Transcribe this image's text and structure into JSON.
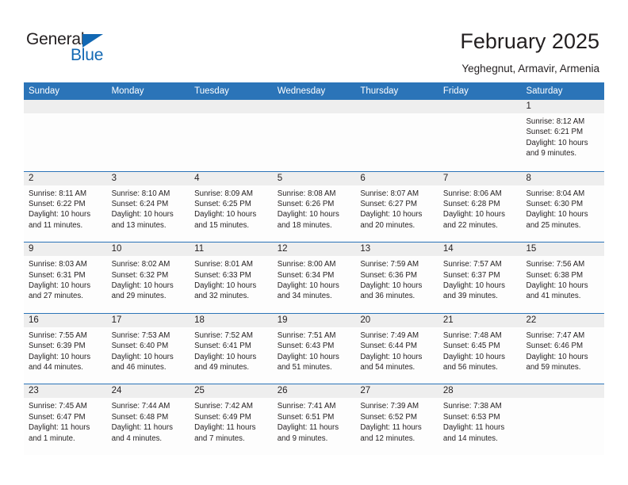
{
  "brand": {
    "name_part1": "General",
    "name_part2": "Blue",
    "accent_color": "#1268b3",
    "triangle_icon": "triangle-icon"
  },
  "header": {
    "title": "February 2025",
    "subtitle": "Yeghegnut, Armavir, Armenia"
  },
  "calendar": {
    "header_bg": "#2b74b8",
    "daynum_bg": "#eeeeee",
    "weekdays": [
      "Sunday",
      "Monday",
      "Tuesday",
      "Wednesday",
      "Thursday",
      "Friday",
      "Saturday"
    ],
    "weeks": [
      [
        {
          "day": "",
          "empty": true
        },
        {
          "day": "",
          "empty": true
        },
        {
          "day": "",
          "empty": true
        },
        {
          "day": "",
          "empty": true
        },
        {
          "day": "",
          "empty": true
        },
        {
          "day": "",
          "empty": true
        },
        {
          "day": "1",
          "sunrise": "Sunrise: 8:12 AM",
          "sunset": "Sunset: 6:21 PM",
          "daylight": "Daylight: 10 hours and 9 minutes."
        }
      ],
      [
        {
          "day": "2",
          "sunrise": "Sunrise: 8:11 AM",
          "sunset": "Sunset: 6:22 PM",
          "daylight": "Daylight: 10 hours and 11 minutes."
        },
        {
          "day": "3",
          "sunrise": "Sunrise: 8:10 AM",
          "sunset": "Sunset: 6:24 PM",
          "daylight": "Daylight: 10 hours and 13 minutes."
        },
        {
          "day": "4",
          "sunrise": "Sunrise: 8:09 AM",
          "sunset": "Sunset: 6:25 PM",
          "daylight": "Daylight: 10 hours and 15 minutes."
        },
        {
          "day": "5",
          "sunrise": "Sunrise: 8:08 AM",
          "sunset": "Sunset: 6:26 PM",
          "daylight": "Daylight: 10 hours and 18 minutes."
        },
        {
          "day": "6",
          "sunrise": "Sunrise: 8:07 AM",
          "sunset": "Sunset: 6:27 PM",
          "daylight": "Daylight: 10 hours and 20 minutes."
        },
        {
          "day": "7",
          "sunrise": "Sunrise: 8:06 AM",
          "sunset": "Sunset: 6:28 PM",
          "daylight": "Daylight: 10 hours and 22 minutes."
        },
        {
          "day": "8",
          "sunrise": "Sunrise: 8:04 AM",
          "sunset": "Sunset: 6:30 PM",
          "daylight": "Daylight: 10 hours and 25 minutes."
        }
      ],
      [
        {
          "day": "9",
          "sunrise": "Sunrise: 8:03 AM",
          "sunset": "Sunset: 6:31 PM",
          "daylight": "Daylight: 10 hours and 27 minutes."
        },
        {
          "day": "10",
          "sunrise": "Sunrise: 8:02 AM",
          "sunset": "Sunset: 6:32 PM",
          "daylight": "Daylight: 10 hours and 29 minutes."
        },
        {
          "day": "11",
          "sunrise": "Sunrise: 8:01 AM",
          "sunset": "Sunset: 6:33 PM",
          "daylight": "Daylight: 10 hours and 32 minutes."
        },
        {
          "day": "12",
          "sunrise": "Sunrise: 8:00 AM",
          "sunset": "Sunset: 6:34 PM",
          "daylight": "Daylight: 10 hours and 34 minutes."
        },
        {
          "day": "13",
          "sunrise": "Sunrise: 7:59 AM",
          "sunset": "Sunset: 6:36 PM",
          "daylight": "Daylight: 10 hours and 36 minutes."
        },
        {
          "day": "14",
          "sunrise": "Sunrise: 7:57 AM",
          "sunset": "Sunset: 6:37 PM",
          "daylight": "Daylight: 10 hours and 39 minutes."
        },
        {
          "day": "15",
          "sunrise": "Sunrise: 7:56 AM",
          "sunset": "Sunset: 6:38 PM",
          "daylight": "Daylight: 10 hours and 41 minutes."
        }
      ],
      [
        {
          "day": "16",
          "sunrise": "Sunrise: 7:55 AM",
          "sunset": "Sunset: 6:39 PM",
          "daylight": "Daylight: 10 hours and 44 minutes."
        },
        {
          "day": "17",
          "sunrise": "Sunrise: 7:53 AM",
          "sunset": "Sunset: 6:40 PM",
          "daylight": "Daylight: 10 hours and 46 minutes."
        },
        {
          "day": "18",
          "sunrise": "Sunrise: 7:52 AM",
          "sunset": "Sunset: 6:41 PM",
          "daylight": "Daylight: 10 hours and 49 minutes."
        },
        {
          "day": "19",
          "sunrise": "Sunrise: 7:51 AM",
          "sunset": "Sunset: 6:43 PM",
          "daylight": "Daylight: 10 hours and 51 minutes."
        },
        {
          "day": "20",
          "sunrise": "Sunrise: 7:49 AM",
          "sunset": "Sunset: 6:44 PM",
          "daylight": "Daylight: 10 hours and 54 minutes."
        },
        {
          "day": "21",
          "sunrise": "Sunrise: 7:48 AM",
          "sunset": "Sunset: 6:45 PM",
          "daylight": "Daylight: 10 hours and 56 minutes."
        },
        {
          "day": "22",
          "sunrise": "Sunrise: 7:47 AM",
          "sunset": "Sunset: 6:46 PM",
          "daylight": "Daylight: 10 hours and 59 minutes."
        }
      ],
      [
        {
          "day": "23",
          "sunrise": "Sunrise: 7:45 AM",
          "sunset": "Sunset: 6:47 PM",
          "daylight": "Daylight: 11 hours and 1 minute."
        },
        {
          "day": "24",
          "sunrise": "Sunrise: 7:44 AM",
          "sunset": "Sunset: 6:48 PM",
          "daylight": "Daylight: 11 hours and 4 minutes."
        },
        {
          "day": "25",
          "sunrise": "Sunrise: 7:42 AM",
          "sunset": "Sunset: 6:49 PM",
          "daylight": "Daylight: 11 hours and 7 minutes."
        },
        {
          "day": "26",
          "sunrise": "Sunrise: 7:41 AM",
          "sunset": "Sunset: 6:51 PM",
          "daylight": "Daylight: 11 hours and 9 minutes."
        },
        {
          "day": "27",
          "sunrise": "Sunrise: 7:39 AM",
          "sunset": "Sunset: 6:52 PM",
          "daylight": "Daylight: 11 hours and 12 minutes."
        },
        {
          "day": "28",
          "sunrise": "Sunrise: 7:38 AM",
          "sunset": "Sunset: 6:53 PM",
          "daylight": "Daylight: 11 hours and 14 minutes."
        },
        {
          "day": "",
          "empty": true
        }
      ]
    ]
  }
}
